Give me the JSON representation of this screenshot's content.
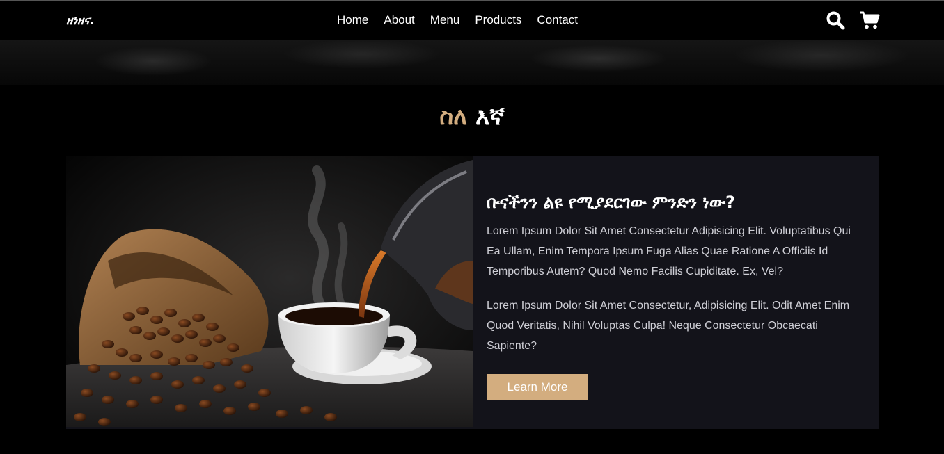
{
  "header": {
    "logo": "ዘነዘና.",
    "nav": [
      "Home",
      "About",
      "Menu",
      "Products",
      "Contact"
    ]
  },
  "about": {
    "title_accent": "ስለ",
    "title_rest": " እኛ",
    "subtitle": "ቡናችንን ልዩ የሚያደርገው ምንድን ነው?",
    "paragraph1": "Lorem Ipsum Dolor Sit Amet Consectetur Adipisicing Elit. Voluptatibus Qui Ea Ullam, Enim Tempora Ipsum Fuga Alias Quae Ratione A Officiis Id Temporibus Autem? Quod Nemo Facilis Cupiditate. Ex, Vel?",
    "paragraph2": "Lorem Ipsum Dolor Sit Amet Consectetur, Adipisicing Elit. Odit Amet Enim Quod Veritatis, Nihil Voluptas Culpa! Neque Consectetur Obcaecati Sapiente?",
    "button": "Learn More"
  },
  "colors": {
    "accent": "#d3ad7f",
    "background": "#000000",
    "card": "#13131a"
  },
  "icons": [
    "search-icon",
    "cart-icon"
  ]
}
